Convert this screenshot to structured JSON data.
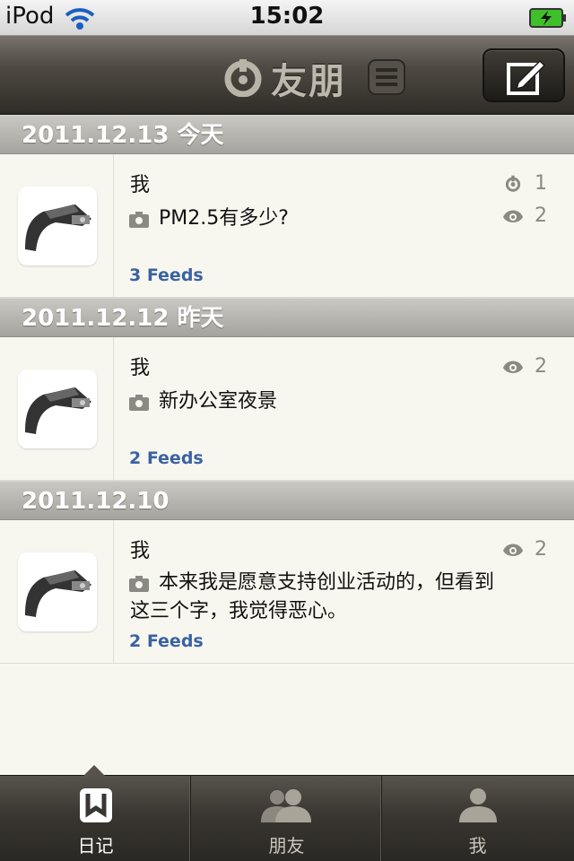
{
  "status_bar": {
    "carrier": "iPod",
    "time": "15:02"
  },
  "nav": {
    "title": "友朋"
  },
  "sections": [
    {
      "date": "2011.12.13 今天",
      "entry": {
        "author": "我",
        "text": "PM2.5有多少?",
        "feeds": "3 Feeds",
        "likes": "1",
        "views": "2"
      }
    },
    {
      "date": "2011.12.12 昨天",
      "entry": {
        "author": "我",
        "text": "新办公室夜景",
        "feeds": "2 Feeds",
        "views": "2"
      }
    },
    {
      "date": "2011.12.10",
      "entry": {
        "author": "我",
        "text": "本来我是愿意支持创业活动的，但看到这三个字，我觉得恶心。",
        "feeds": "2 Feeds",
        "views": "2"
      }
    }
  ],
  "tabs": [
    {
      "label": "日记",
      "icon": "diary-icon",
      "active": true
    },
    {
      "label": "朋友",
      "icon": "friends-icon",
      "active": false
    },
    {
      "label": "我",
      "icon": "me-icon",
      "active": false
    }
  ],
  "colors": {
    "link": "#3a62a2",
    "background": "#f8f7ef",
    "navbar": "#3a3732"
  }
}
